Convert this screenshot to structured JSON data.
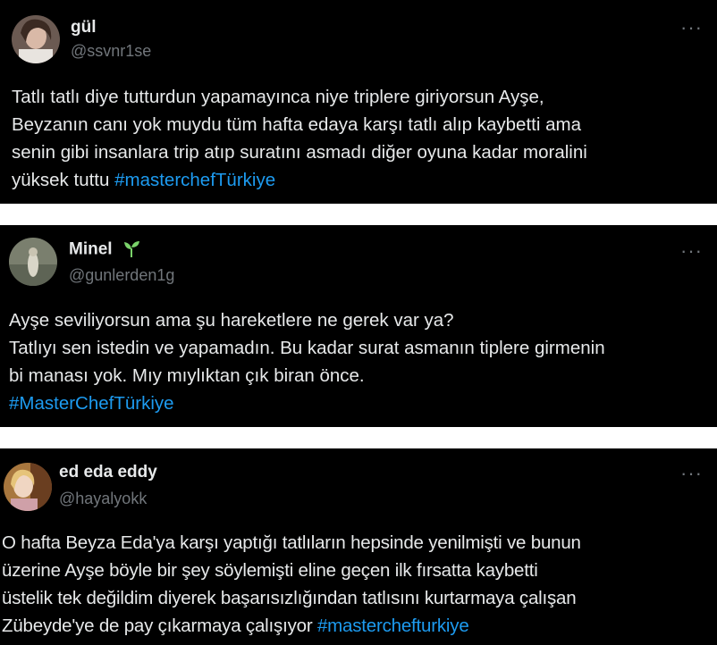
{
  "tweets": [
    {
      "name": "gül",
      "handle": "@ssvnr1se",
      "text": "Tatlı tatlı diye tutturdun yapamayınca niye triplere giriyorsun Ayşe,\nBeyzanın canı yok muydu tüm hafta edaya karşı tatlı alıp kaybetti ama\nsenin gibi insanlara trip atıp suratını asmadı diğer oyuna kadar moralini\nyüksek tuttu ",
      "hashtag": "#masterchefTürkiye",
      "more": "···"
    },
    {
      "name": "Minel",
      "handle": "@gunlerden1g",
      "text": "Ayşe seviliyorsun ama şu hareketlere ne gerek var ya?\nTatlıyı sen istedin ve yapamadın. Bu kadar surat asmanın tiplere girmenin\nbi manası yok. Mıy mıylıktan çık biran önce.\n",
      "hashtag": "#MasterChefTürkiye",
      "more": "···",
      "badge_icon": "seedling-icon",
      "badge_color": "#7ad26a"
    },
    {
      "name": "ed eda eddy",
      "handle": "@hayalyokk",
      "text": "O hafta Beyza Eda'ya karşı yaptığı tatlıların hepsinde yenilmişti ve bunun\nüzerine Ayşe böyle bir şey söylemişti eline geçen ilk fırsatta kaybetti\nüstelik tek değildim diyerek başarısızlığından tatlısını kurtarmaya çalışan\nZübeyde'ye de pay çıkarmaya çalışıyor  ",
      "hashtag": "#masterchefturkiye",
      "more": "···"
    }
  ],
  "colors": {
    "card_bg": "#000000",
    "text": "#e7e9ea",
    "secondary": "#71767b",
    "hashtag": "#1d9bf0"
  }
}
